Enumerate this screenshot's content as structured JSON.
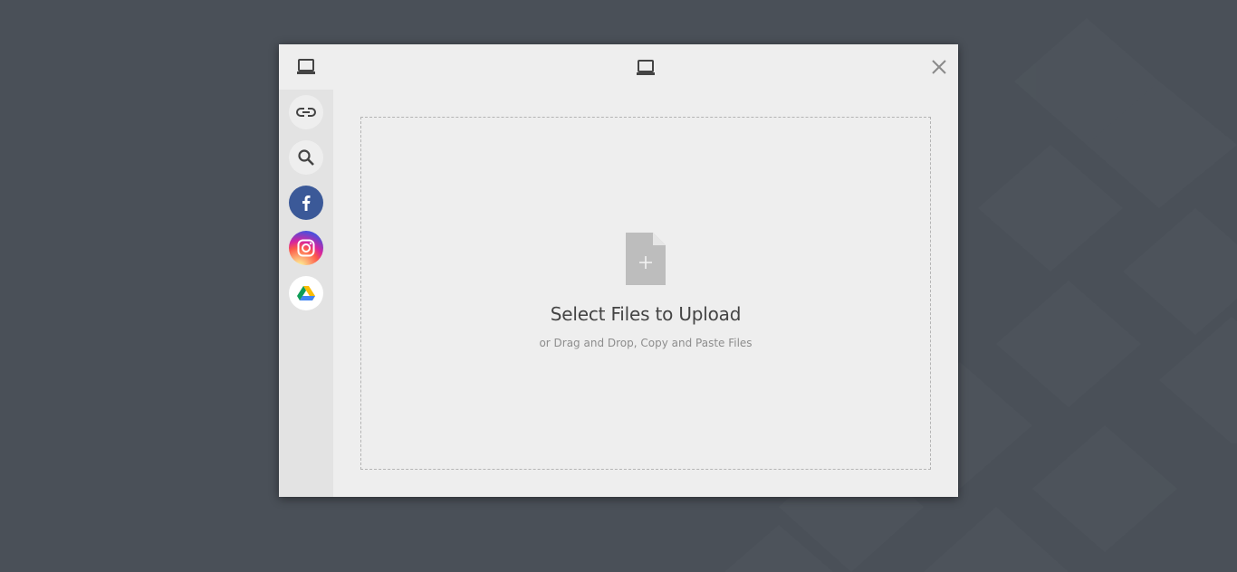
{
  "modal": {
    "header_icon": "laptop-icon",
    "center_icon": "laptop-icon",
    "close_icon": "close-icon"
  },
  "sidebar": {
    "items": [
      {
        "name": "link",
        "icon": "link-icon"
      },
      {
        "name": "search",
        "icon": "search-icon"
      },
      {
        "name": "facebook",
        "icon": "facebook-icon",
        "color": "#3b5998"
      },
      {
        "name": "instagram",
        "icon": "instagram-icon"
      },
      {
        "name": "google-drive",
        "icon": "google-drive-icon"
      }
    ]
  },
  "dropzone": {
    "title": "Select Files to Upload",
    "subtitle": "or Drag and Drop, Copy and Paste Files",
    "icon": "file-plus-icon"
  },
  "colors": {
    "background": "#4a5058",
    "modal": "#eeeeee",
    "sidebar": "#e3e3e3",
    "facebook": "#3b5998"
  }
}
